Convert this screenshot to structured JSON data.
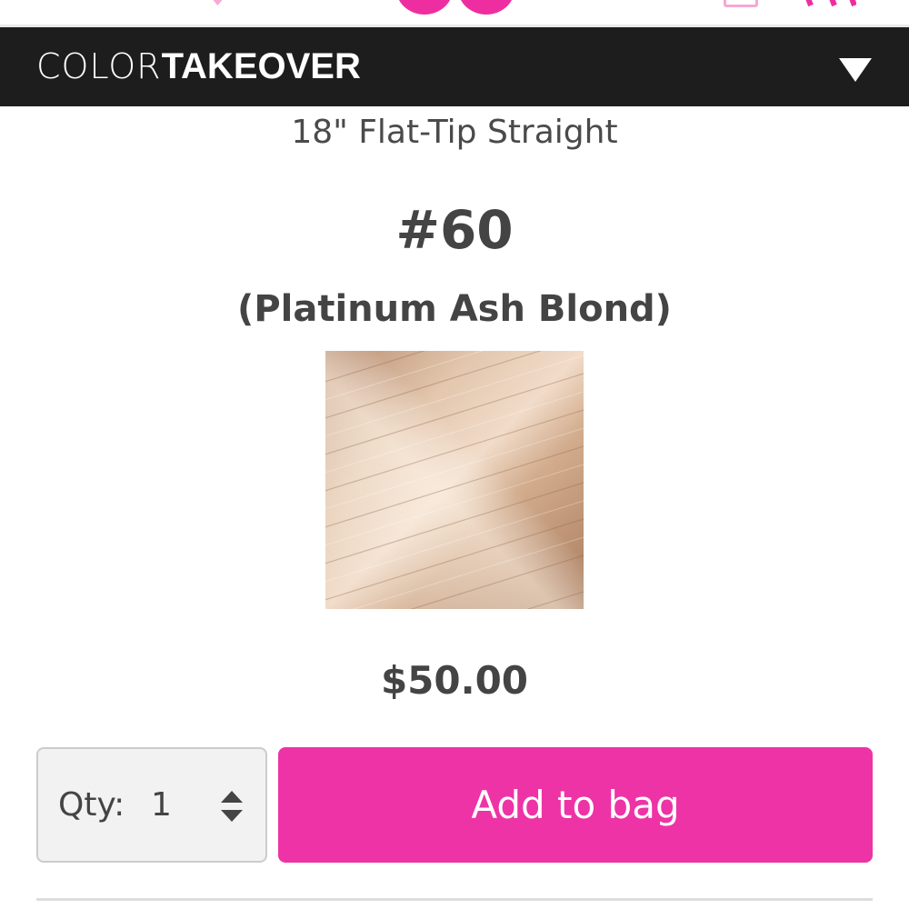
{
  "brand": {
    "wordmark_light": "COLOR",
    "wordmark_bold": "TAKEOVER"
  },
  "product": {
    "subtitle": "18\" Flat-Tip Straight",
    "shade_code": "#60",
    "shade_name": "(Platinum Ash Blond)",
    "price": "$50.00"
  },
  "quantity": {
    "label": "Qty:",
    "value": "1"
  },
  "actions": {
    "add_to_bag": "Add to bag"
  },
  "icons": {
    "menu": "chevron-down-icon",
    "wishlist": "heart-icon",
    "account": "account-icon",
    "cart": "cart-icon",
    "qty_stepper": "up-down-arrows-icon"
  },
  "colors": {
    "accent_pink": "#ee33a6",
    "brand_bar": "#1d1d1d",
    "text": "#444444"
  }
}
